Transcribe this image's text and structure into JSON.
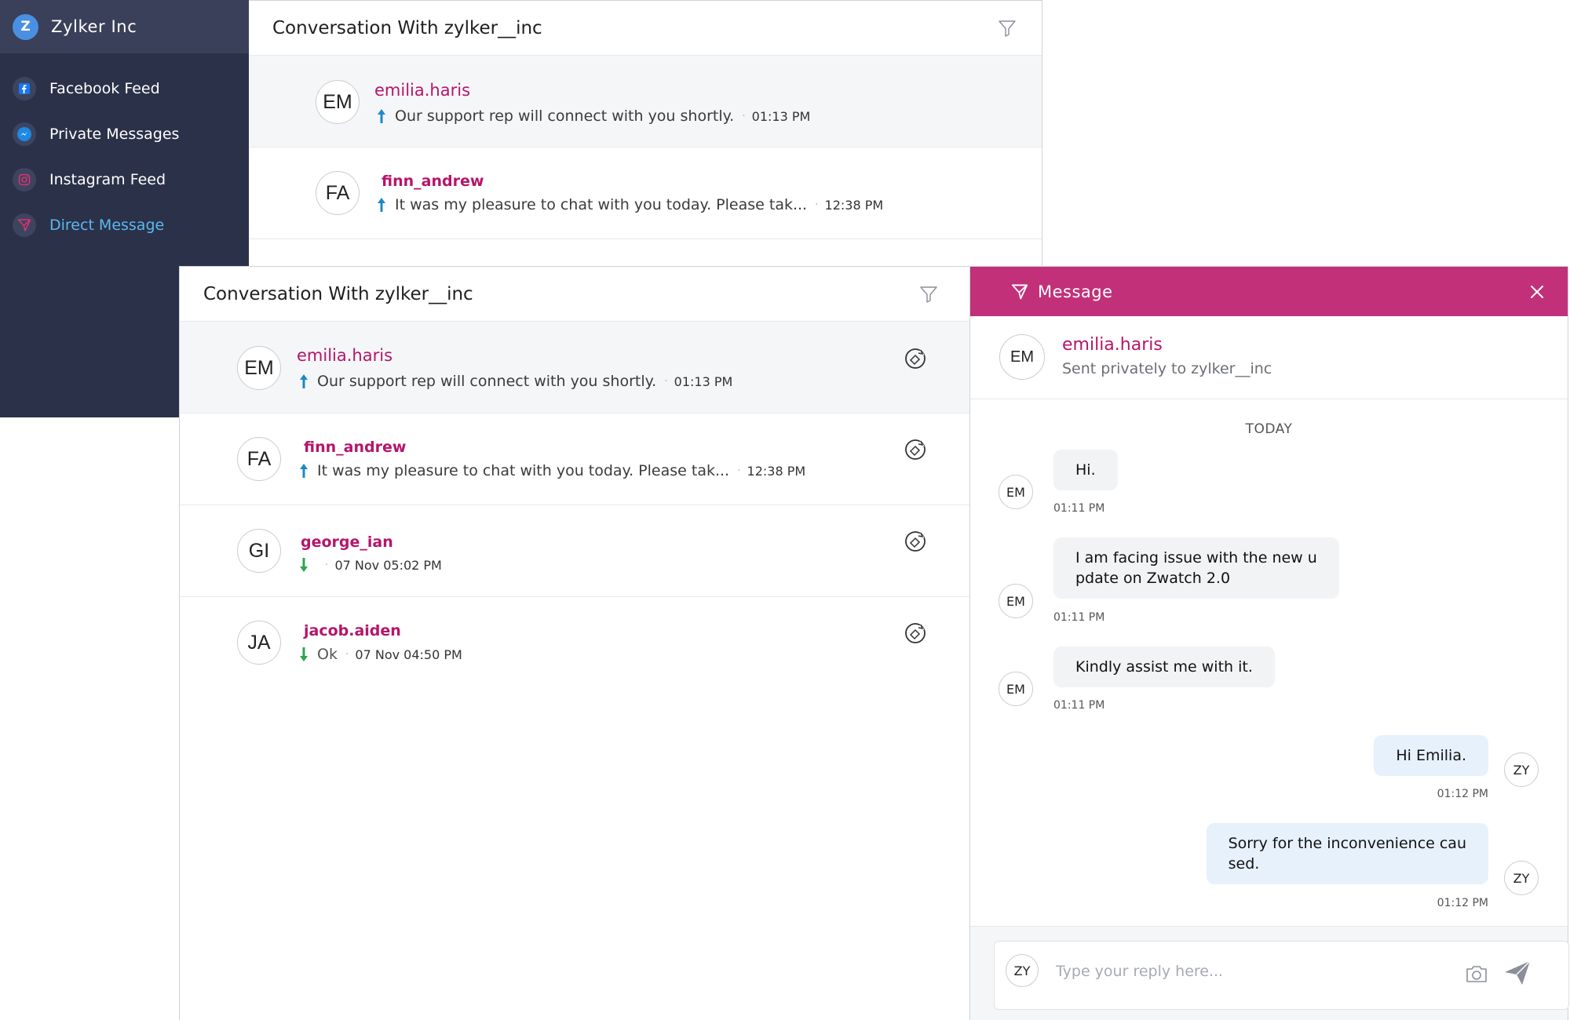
{
  "colors": {
    "sidebar_bg": "#2b3148",
    "brand_bar": "#3a4059",
    "accent_pink": "#b5156b",
    "message_header": "#c2307a",
    "active_nav": "#5bb8f0",
    "outgoing_bubble": "#e7f1fc",
    "incoming_bubble": "#f2f3f5"
  },
  "sidebar": {
    "brand_initial": "Z",
    "brand_name": "Zylker Inc",
    "items": [
      {
        "label": "Facebook Feed",
        "icon": "facebook-icon"
      },
      {
        "label": "Private Messages",
        "icon": "messenger-icon"
      },
      {
        "label": "Instagram Feed",
        "icon": "instagram-icon"
      },
      {
        "label": "Direct Message",
        "icon": "direct-message-icon",
        "active": true
      }
    ]
  },
  "back_panel": {
    "title": "Conversation With zylker__inc",
    "rows": [
      {
        "initials": "EM",
        "name": "emilia.haris",
        "preview": "Our support rep will connect with you shortly.",
        "time": "01:13 PM",
        "direction": "outgoing"
      },
      {
        "initials": "FA",
        "name": "finn_andrew",
        "preview": "It was my pleasure to chat with you today. Please tak...",
        "time": "12:38 PM",
        "direction": "outgoing"
      }
    ]
  },
  "front_panel": {
    "title": "Conversation With zylker__inc",
    "rows": [
      {
        "initials": "EM",
        "name": "emilia.haris",
        "preview": "Our support rep will connect with you shortly.",
        "time": "01:13 PM",
        "direction": "outgoing"
      },
      {
        "initials": "FA",
        "name": "finn_andrew",
        "preview": "It was my pleasure to chat with you today. Please tak...",
        "time": "12:38 PM",
        "direction": "outgoing"
      },
      {
        "initials": "GI",
        "name": "george_ian",
        "preview": "",
        "time": "07 Nov 05:02 PM",
        "direction": "incoming"
      },
      {
        "initials": "JA",
        "name": "jacob.aiden",
        "preview": "Ok",
        "time": "07 Nov 04:50 PM",
        "direction": "incoming"
      }
    ]
  },
  "message_panel": {
    "title": "Message",
    "sender": {
      "initials": "EM",
      "name": "emilia.haris",
      "subtitle": "Sent privately to zylker__inc"
    },
    "day_label": "TODAY",
    "messages": [
      {
        "from": "EM",
        "text": "Hi.",
        "time": "01:11 PM"
      },
      {
        "from": "EM",
        "text": "I am facing issue with the new u pdate on Zwatch 2.0",
        "line1": "I am facing issue with the new u",
        "line2": "pdate on Zwatch 2.0",
        "time": "01:11 PM"
      },
      {
        "from": "EM",
        "text": "Kindly assist me with it.",
        "time": "01:11 PM"
      },
      {
        "from": "ZY",
        "text": "Hi Emilia.",
        "time": "01:12 PM"
      },
      {
        "from": "ZY",
        "text": "Sorry for the inconvenience cau sed.",
        "line1": "Sorry for the inconvenience cau",
        "line2": "sed.",
        "time": "01:12 PM"
      }
    ],
    "reply": {
      "avatar": "ZY",
      "placeholder": "Type your reply here..."
    }
  }
}
